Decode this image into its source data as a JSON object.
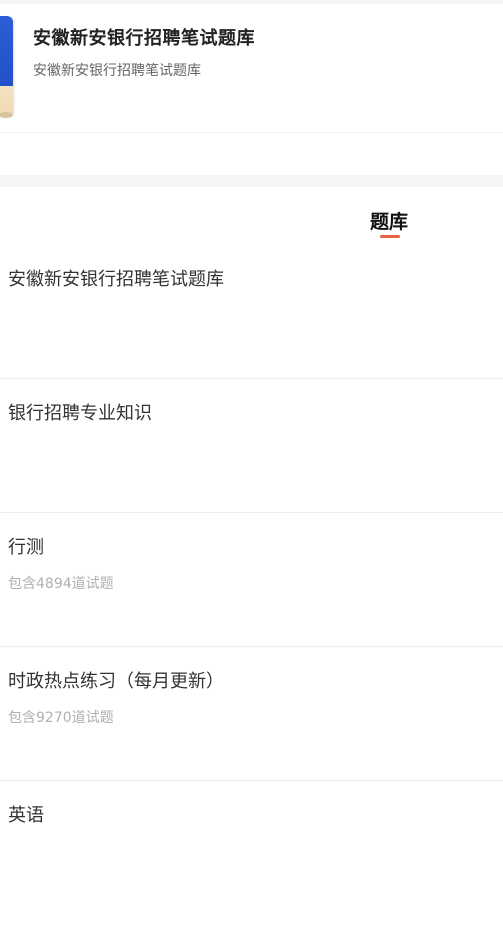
{
  "header": {
    "title": "安徽新安银行招聘笔试题库",
    "subtitle": "安徽新安银行招聘笔试题库",
    "cover_icon": "book-cover",
    "cover_colors": {
      "primary": "#2350c9",
      "bottom": "#efd9b2"
    }
  },
  "tabs": [
    {
      "label": "题库",
      "active": true
    }
  ],
  "accent_color": "#e8633f",
  "question_banks": [
    {
      "name": "安徽新安银行招聘笔试题库",
      "count_text": ""
    },
    {
      "name": "银行招聘专业知识",
      "count_text": ""
    },
    {
      "name": "行测",
      "count_text": "包含4894道试题"
    },
    {
      "name": "时政热点练习（每月更新）",
      "count_text": "包含9270道试题"
    },
    {
      "name": "英语",
      "count_text": ""
    }
  ]
}
